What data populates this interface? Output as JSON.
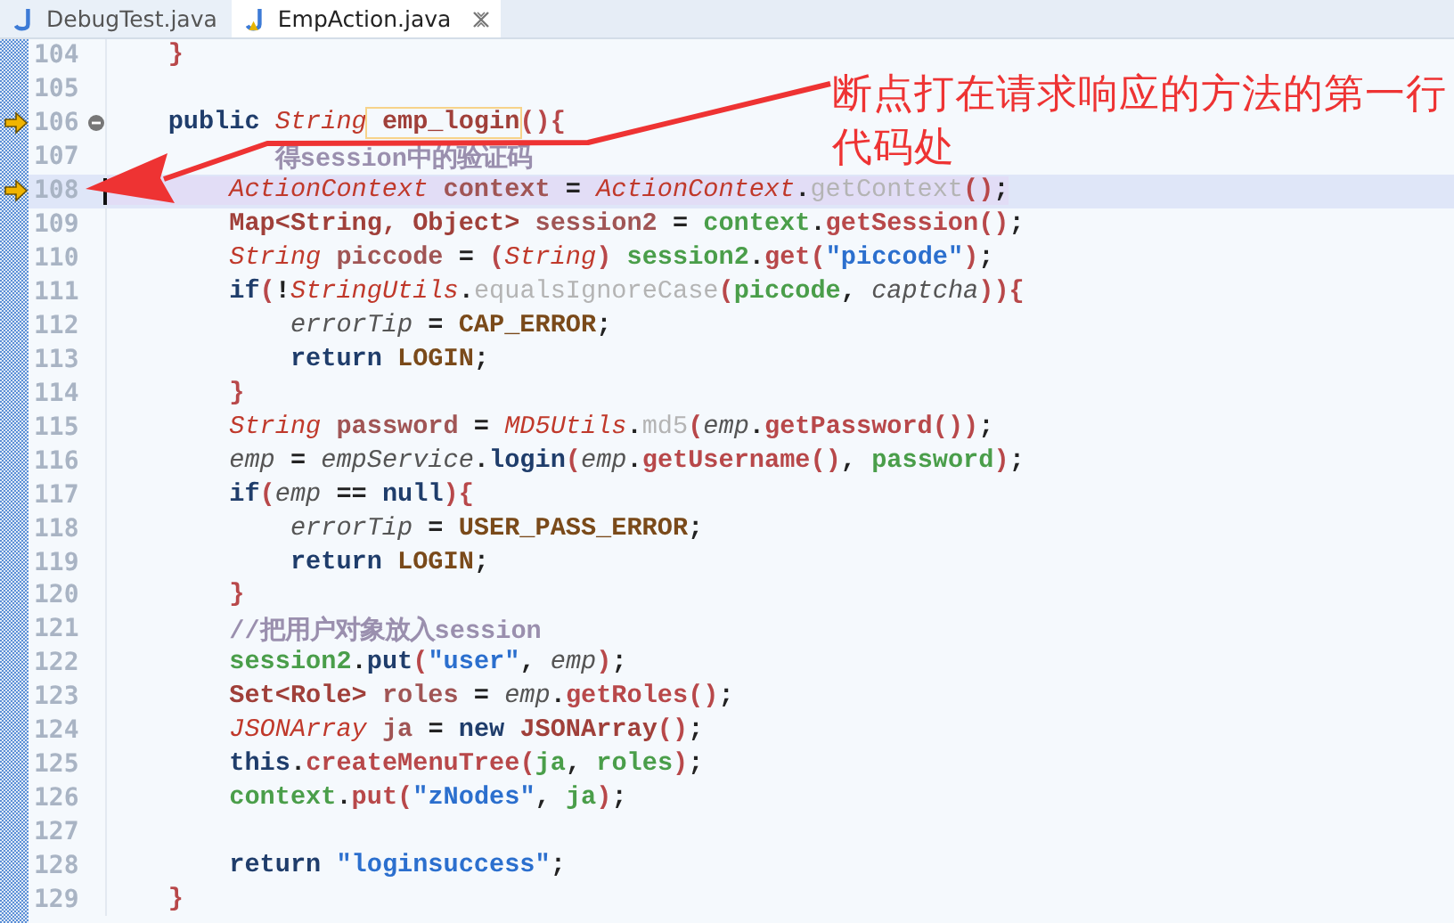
{
  "tabs": [
    {
      "label": "DebugTest.java",
      "selected": false,
      "warning": false
    },
    {
      "label": "EmpAction.java",
      "selected": true,
      "warning": true
    }
  ],
  "editor": {
    "lines": [
      {
        "number": "104",
        "tokens": [
          {
            "kind": "br",
            "text": "    }"
          }
        ]
      },
      {
        "number": "105"
      },
      {
        "number": "106",
        "breakpoint": true,
        "fold": true,
        "tokens": [
          {
            "kind": "kw",
            "text": "    public"
          },
          {
            "kind": "ti",
            "text": " String"
          },
          {
            "kind": "occ",
            "text": " emp_login"
          },
          {
            "kind": "br",
            "text": "(){"
          }
        ]
      },
      {
        "number": "107",
        "tokens": [
          {
            "kind": "cm",
            "text": "           得session中的验证码"
          }
        ]
      },
      {
        "number": "108",
        "breakpoint": true,
        "current": true,
        "tokens": [
          {
            "kind": "ti",
            "text": "        ActionContext"
          },
          {
            "kind": "decl",
            "text": " context"
          },
          {
            "kind": "p",
            "text": " = "
          },
          {
            "kind": "ti",
            "text": "ActionContext"
          },
          {
            "kind": "p",
            "text": "."
          },
          {
            "kind": "sm",
            "text": "getContext"
          },
          {
            "kind": "br",
            "text": "()"
          },
          {
            "kind": "p",
            "text": ";"
          }
        ]
      },
      {
        "number": "109",
        "tokens": [
          {
            "kind": "ty",
            "text": "        Map<String, Object>"
          },
          {
            "kind": "decl",
            "text": " session2"
          },
          {
            "kind": "p",
            "text": " = "
          },
          {
            "kind": "loc",
            "text": "context"
          },
          {
            "kind": "p",
            "text": "."
          },
          {
            "kind": "m",
            "text": "getSession"
          },
          {
            "kind": "br",
            "text": "()"
          },
          {
            "kind": "p",
            "text": ";"
          }
        ]
      },
      {
        "number": "110",
        "tokens": [
          {
            "kind": "ti",
            "text": "        String"
          },
          {
            "kind": "decl",
            "text": " piccode"
          },
          {
            "kind": "p",
            "text": " = "
          },
          {
            "kind": "br",
            "text": "("
          },
          {
            "kind": "ti",
            "text": "String"
          },
          {
            "kind": "br",
            "text": ")"
          },
          {
            "kind": "loc",
            "text": " session2"
          },
          {
            "kind": "p",
            "text": "."
          },
          {
            "kind": "m",
            "text": "get"
          },
          {
            "kind": "br",
            "text": "("
          },
          {
            "kind": "s",
            "text": "\"piccode\""
          },
          {
            "kind": "br",
            "text": ")"
          },
          {
            "kind": "p",
            "text": ";"
          }
        ]
      },
      {
        "number": "111",
        "tokens": [
          {
            "kind": "kw",
            "text": "        if"
          },
          {
            "kind": "br",
            "text": "("
          },
          {
            "kind": "p",
            "text": "!"
          },
          {
            "kind": "ti",
            "text": "StringUtils"
          },
          {
            "kind": "p",
            "text": "."
          },
          {
            "kind": "sm",
            "text": "equalsIgnoreCase"
          },
          {
            "kind": "br",
            "text": "("
          },
          {
            "kind": "loc",
            "text": "piccode"
          },
          {
            "kind": "p",
            "text": ", "
          },
          {
            "kind": "fi",
            "text": "captcha"
          },
          {
            "kind": "br",
            "text": ")){"
          }
        ]
      },
      {
        "number": "112",
        "tokens": [
          {
            "kind": "fi",
            "text": "            errorTip"
          },
          {
            "kind": "p",
            "text": " = "
          },
          {
            "kind": "c",
            "text": "CAP_ERROR"
          },
          {
            "kind": "p",
            "text": ";"
          }
        ]
      },
      {
        "number": "113",
        "tokens": [
          {
            "kind": "kw",
            "text": "            return"
          },
          {
            "kind": "c",
            "text": " LOGIN"
          },
          {
            "kind": "p",
            "text": ";"
          }
        ]
      },
      {
        "number": "114",
        "tokens": [
          {
            "kind": "br",
            "text": "        }"
          }
        ]
      },
      {
        "number": "115",
        "tokens": [
          {
            "kind": "ti",
            "text": "        String"
          },
          {
            "kind": "decl",
            "text": " password"
          },
          {
            "kind": "p",
            "text": " = "
          },
          {
            "kind": "ti",
            "text": "MD5Utils"
          },
          {
            "kind": "p",
            "text": "."
          },
          {
            "kind": "sm",
            "text": "md5"
          },
          {
            "kind": "br",
            "text": "("
          },
          {
            "kind": "fi",
            "text": "emp"
          },
          {
            "kind": "p",
            "text": "."
          },
          {
            "kind": "m",
            "text": "getPassword"
          },
          {
            "kind": "br",
            "text": "())"
          },
          {
            "kind": "p",
            "text": ";"
          }
        ]
      },
      {
        "number": "116",
        "tokens": [
          {
            "kind": "fi",
            "text": "        emp"
          },
          {
            "kind": "p",
            "text": " = "
          },
          {
            "kind": "fi",
            "text": "empService"
          },
          {
            "kind": "p",
            "text": "."
          },
          {
            "kind": "kw",
            "text": "login"
          },
          {
            "kind": "br",
            "text": "("
          },
          {
            "kind": "fi",
            "text": "emp"
          },
          {
            "kind": "p",
            "text": "."
          },
          {
            "kind": "m",
            "text": "getUsername"
          },
          {
            "kind": "br",
            "text": "()"
          },
          {
            "kind": "p",
            "text": ", "
          },
          {
            "kind": "loc",
            "text": "password"
          },
          {
            "kind": "br",
            "text": ")"
          },
          {
            "kind": "p",
            "text": ";"
          }
        ]
      },
      {
        "number": "117",
        "tokens": [
          {
            "kind": "kw",
            "text": "        if"
          },
          {
            "kind": "br",
            "text": "("
          },
          {
            "kind": "fi",
            "text": "emp"
          },
          {
            "kind": "p",
            "text": " == "
          },
          {
            "kind": "kw",
            "text": "null"
          },
          {
            "kind": "br",
            "text": "){"
          }
        ]
      },
      {
        "number": "118",
        "tokens": [
          {
            "kind": "fi",
            "text": "            errorTip"
          },
          {
            "kind": "p",
            "text": " = "
          },
          {
            "kind": "c",
            "text": "USER_PASS_ERROR"
          },
          {
            "kind": "p",
            "text": ";"
          }
        ]
      },
      {
        "number": "119",
        "tokens": [
          {
            "kind": "kw",
            "text": "            return"
          },
          {
            "kind": "c",
            "text": " LOGIN"
          },
          {
            "kind": "p",
            "text": ";"
          }
        ]
      },
      {
        "number": "120",
        "tokens": [
          {
            "kind": "br",
            "text": "        }"
          }
        ]
      },
      {
        "number": "121",
        "tokens": [
          {
            "kind": "cm",
            "text": "        //把用户对象放入session"
          }
        ]
      },
      {
        "number": "122",
        "tokens": [
          {
            "kind": "loc",
            "text": "        session2"
          },
          {
            "kind": "p",
            "text": "."
          },
          {
            "kind": "kw",
            "text": "put"
          },
          {
            "kind": "br",
            "text": "("
          },
          {
            "kind": "s",
            "text": "\"user\""
          },
          {
            "kind": "p",
            "text": ", "
          },
          {
            "kind": "fi",
            "text": "emp"
          },
          {
            "kind": "br",
            "text": ")"
          },
          {
            "kind": "p",
            "text": ";"
          }
        ]
      },
      {
        "number": "123",
        "tokens": [
          {
            "kind": "ty",
            "text": "        Set<Role>"
          },
          {
            "kind": "decl",
            "text": " roles"
          },
          {
            "kind": "p",
            "text": " = "
          },
          {
            "kind": "fi",
            "text": "emp"
          },
          {
            "kind": "p",
            "text": "."
          },
          {
            "kind": "m",
            "text": "getRoles"
          },
          {
            "kind": "br",
            "text": "()"
          },
          {
            "kind": "p",
            "text": ";"
          }
        ]
      },
      {
        "number": "124",
        "tokens": [
          {
            "kind": "ti",
            "text": "        JSONArray"
          },
          {
            "kind": "decl",
            "text": " ja"
          },
          {
            "kind": "p",
            "text": " = "
          },
          {
            "kind": "kw",
            "text": "new"
          },
          {
            "kind": "ty",
            "text": " JSONArray"
          },
          {
            "kind": "br",
            "text": "()"
          },
          {
            "kind": "p",
            "text": ";"
          }
        ]
      },
      {
        "number": "125",
        "tokens": [
          {
            "kind": "kw",
            "text": "        this"
          },
          {
            "kind": "p",
            "text": "."
          },
          {
            "kind": "m",
            "text": "createMenuTree"
          },
          {
            "kind": "br",
            "text": "("
          },
          {
            "kind": "loc",
            "text": "ja"
          },
          {
            "kind": "p",
            "text": ", "
          },
          {
            "kind": "loc",
            "text": "roles"
          },
          {
            "kind": "br",
            "text": ")"
          },
          {
            "kind": "p",
            "text": ";"
          }
        ]
      },
      {
        "number": "126",
        "tokens": [
          {
            "kind": "loc",
            "text": "        context"
          },
          {
            "kind": "p",
            "text": "."
          },
          {
            "kind": "m",
            "text": "put"
          },
          {
            "kind": "br",
            "text": "("
          },
          {
            "kind": "s",
            "text": "\"zNodes\""
          },
          {
            "kind": "p",
            "text": ", "
          },
          {
            "kind": "loc",
            "text": "ja"
          },
          {
            "kind": "br",
            "text": ")"
          },
          {
            "kind": "p",
            "text": ";"
          }
        ]
      },
      {
        "number": "127"
      },
      {
        "number": "128",
        "tokens": [
          {
            "kind": "kw",
            "text": "        return"
          },
          {
            "kind": "s",
            "text": " \"loginsuccess\""
          },
          {
            "kind": "p",
            "text": ";"
          }
        ]
      },
      {
        "number": "129",
        "tokens": [
          {
            "kind": "br",
            "text": "    }"
          }
        ]
      }
    ]
  },
  "annotation": {
    "text": "断点打在请求响应的方法的第一行代码处"
  }
}
